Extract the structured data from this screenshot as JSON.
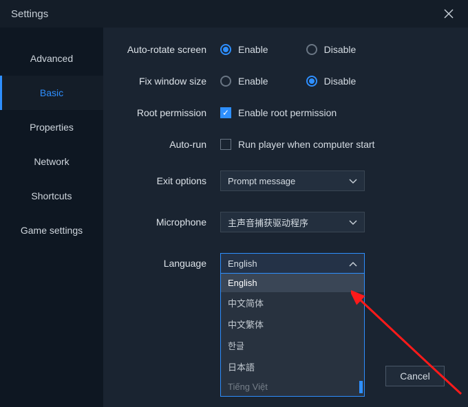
{
  "window": {
    "title": "Settings"
  },
  "sidebar": {
    "items": [
      {
        "label": "Advanced"
      },
      {
        "label": "Basic"
      },
      {
        "label": "Properties"
      },
      {
        "label": "Network"
      },
      {
        "label": "Shortcuts"
      },
      {
        "label": "Game settings"
      }
    ],
    "active_index": 1
  },
  "settings": {
    "auto_rotate": {
      "label": "Auto-rotate screen",
      "enable": "Enable",
      "disable": "Disable",
      "value": "enable"
    },
    "fix_window": {
      "label": "Fix window size",
      "enable": "Enable",
      "disable": "Disable",
      "value": "disable"
    },
    "root": {
      "label": "Root permission",
      "checkbox_label": "Enable root permission",
      "checked": true
    },
    "auto_run": {
      "label": "Auto-run",
      "checkbox_label": "Run player when computer start",
      "checked": false
    },
    "exit": {
      "label": "Exit options",
      "value": "Prompt message"
    },
    "microphone": {
      "label": "Microphone",
      "value": "主声音捕获驱动程序"
    },
    "language": {
      "label": "Language",
      "value": "English",
      "options": [
        "English",
        "中文简体",
        "中文繁体",
        "한글",
        "日本語",
        "Tiếng Việt"
      ]
    }
  },
  "buttons": {
    "cancel": "Cancel"
  }
}
